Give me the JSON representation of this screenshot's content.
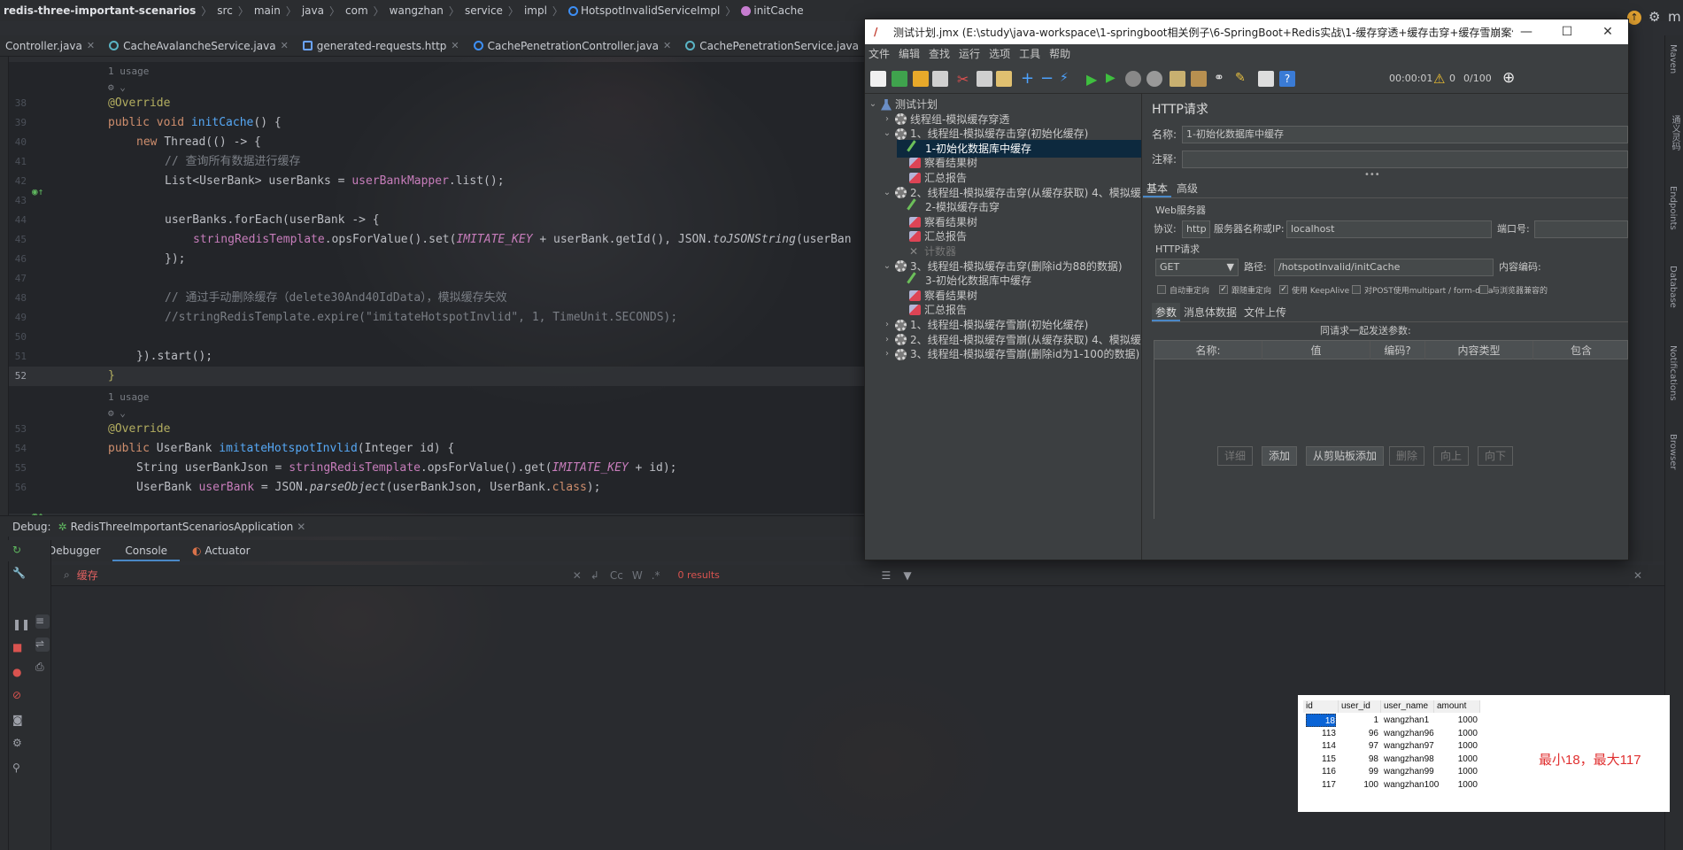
{
  "breadcrumb": [
    "redis-three-important-scenarios",
    "src",
    "main",
    "java",
    "com",
    "wangzhan",
    "service",
    "impl",
    "HotspotInvalidServiceImpl",
    "initCache"
  ],
  "editor_tabs": [
    "Controller.java",
    "CacheAvalancheService.java",
    "generated-requests.http",
    "CachePenetrationController.java",
    "CachePenetrationService.java"
  ],
  "editor": {
    "usage1": "1 usage",
    "usage2": "1 usage",
    "ln": [
      "38",
      "39",
      "40",
      "41",
      "42",
      "43",
      "44",
      "45",
      "46",
      "47",
      "48",
      "49",
      "50",
      "51",
      "52",
      "53",
      "54",
      "55",
      "56"
    ],
    "l38_ann": "@Override",
    "l39_kw": "public void ",
    "l39_fn": "initCache",
    "l39_rest": "() {",
    "l40_kw": "new ",
    "l40_rest": "Thread(() -> {",
    "l41_cmt": "// 查询所有数据进行缓存",
    "l42_a": "List<UserBank> userBanks = ",
    "l42_f": "userBankMapper",
    "l42_b": ".list();",
    "l44_a": "userBanks.forEach(userBank -> {",
    "l45_f": "stringRedisTemplate",
    "l45_a": ".opsForValue().set(",
    "l45_c": "IMITATE_KEY",
    "l45_b": " + userBank.getId(), JSON.",
    "l45_i": "toJSONString",
    "l45_d": "(userBan",
    "l46_a": "});",
    "l48_cmt": "// 通过手动删除缓存（delete30And40IdData），模拟缓存失效",
    "l49_cmt": "//stringRedisTemplate.expire(\"imitateHotspotInvlid\", 1, TimeUnit.SECONDS);",
    "l51_a": "}).start();",
    "l52_a": "}",
    "l53_ann": "@Override",
    "l54_kw": "public ",
    "l54_a": "UserBank ",
    "l54_fn": "imitateHotspotInvlid",
    "l54_b": "(Integer id) {",
    "l55_a": "String userBankJson = ",
    "l55_f": "stringRedisTemplate",
    "l55_b": ".opsForValue().get(",
    "l55_c": "IMITATE_KEY",
    "l55_d": " + id);",
    "l56_a": "UserBank ",
    "l56_f": "userBank",
    "l56_b": " = JSON.",
    "l56_i": "parseObject",
    "l56_c": "(userBankJson, UserBank.",
    "l56_k": "class",
    "l56_d": ");"
  },
  "debug": {
    "label": "Debug:",
    "config": "RedisThreeImportantScenariosApplication",
    "tabs": [
      "Debugger",
      "Console",
      "Actuator"
    ],
    "search_value": "缓存",
    "results": "0 results",
    "opts": [
      "Cc",
      "W"
    ]
  },
  "right_tools": [
    "Maven",
    "通义灵码",
    "Endpoints",
    "Database",
    "Notifications",
    "Browser"
  ],
  "jmeter": {
    "title": "测试计划.jmx (E:\\study\\java-workspace\\1-springboot相关例子\\6-SpringBoot+Redis实战\\1-缓存穿透+缓存击穿+缓存雪崩案例及解...",
    "menu": [
      "文件",
      "编辑",
      "查找",
      "运行",
      "选项",
      "工具",
      "帮助"
    ],
    "timer": "00:00:01",
    "warn_count": "0",
    "threads": "0/100",
    "tree": [
      {
        "label": "测试计划",
        "type": "flask",
        "indent": 0,
        "exp": "v"
      },
      {
        "label": "线程组-模拟缓存穿透",
        "type": "gear",
        "indent": 1,
        "exp": ">"
      },
      {
        "label": "1、线程组-模拟缓存击穿(初始化缓存)",
        "type": "gear",
        "indent": 1,
        "exp": "v"
      },
      {
        "label": "1-初始化数据库中缓存",
        "type": "sampler",
        "indent": 2,
        "exp": "",
        "sel": true
      },
      {
        "label": "察看结果树",
        "type": "listener",
        "indent": 2,
        "exp": ""
      },
      {
        "label": "汇总报告",
        "type": "listener",
        "indent": 2,
        "exp": ""
      },
      {
        "label": "2、线程组-模拟缓存击穿(从缓存获取) 4、模拟缓",
        "type": "gear",
        "indent": 1,
        "exp": "v"
      },
      {
        "label": "2-模拟缓存击穿",
        "type": "sampler",
        "indent": 2,
        "exp": ""
      },
      {
        "label": "察看结果树",
        "type": "listener",
        "indent": 2,
        "exp": ""
      },
      {
        "label": "汇总报告",
        "type": "listener",
        "indent": 2,
        "exp": ""
      },
      {
        "label": "计数器",
        "type": "tool",
        "indent": 2,
        "exp": "",
        "dim": true
      },
      {
        "label": "3、线程组-模拟缓存击穿(删除id为88的数据)",
        "type": "gear",
        "indent": 1,
        "exp": "v"
      },
      {
        "label": "3-初始化数据库中缓存",
        "type": "sampler",
        "indent": 2,
        "exp": ""
      },
      {
        "label": "察看结果树",
        "type": "listener",
        "indent": 2,
        "exp": ""
      },
      {
        "label": "汇总报告",
        "type": "listener",
        "indent": 2,
        "exp": ""
      },
      {
        "label": "1、线程组-模拟缓存雪崩(初始化缓存)",
        "type": "gear",
        "indent": 1,
        "exp": ">"
      },
      {
        "label": "2、线程组-模拟缓存雪崩(从缓存获取) 4、模拟缓",
        "type": "gear",
        "indent": 1,
        "exp": ">"
      },
      {
        "label": "3、线程组-模拟缓存雪崩(删除id为1-100的数据)",
        "type": "gear",
        "indent": 1,
        "exp": ">"
      }
    ],
    "panel": {
      "header": "HTTP请求",
      "name_label": "名称:",
      "name_value": "1-初始化数据库中缓存",
      "comment_label": "注释:",
      "comment_value": "",
      "tabs": [
        "基本",
        "高级"
      ],
      "web_server": "Web服务器",
      "protocol_label": "协议:",
      "protocol_value": "http",
      "server_label": "服务器名称或IP:",
      "server_value": "localhost",
      "port_label": "端口号:",
      "http_section": "HTTP请求",
      "method": "GET",
      "path_label": "路径:",
      "path_value": "/hotspotInvalid/initCache",
      "encoding_label": "内容编码:",
      "checkboxes": [
        {
          "label": "自动重定向",
          "checked": false
        },
        {
          "label": "跟随重定向",
          "checked": true
        },
        {
          "label": "使用 KeepAlive",
          "checked": true
        },
        {
          "label": "对POST使用multipart / form-data",
          "checked": false
        },
        {
          "label": "与浏览器兼容的",
          "checked": false
        }
      ],
      "param_tabs": [
        "参数",
        "消息体数据",
        "文件上传"
      ],
      "params_caption": "同请求一起发送参数:",
      "columns": [
        "名称:",
        "值",
        "编码?",
        "内容类型",
        "包含"
      ],
      "buttons": [
        {
          "label": "详细",
          "enabled": false
        },
        {
          "label": "添加",
          "enabled": true
        },
        {
          "label": "从剪贴板添加",
          "enabled": true
        },
        {
          "label": "删除",
          "enabled": false
        },
        {
          "label": "向上",
          "enabled": false
        },
        {
          "label": "向下",
          "enabled": false
        }
      ]
    }
  },
  "db_table": {
    "columns": [
      "id",
      "user_id",
      "user_name",
      "amount"
    ],
    "rows": [
      [
        "18",
        "1",
        "wangzhan1",
        "1000"
      ],
      [
        "113",
        "96",
        "wangzhan96",
        "1000"
      ],
      [
        "114",
        "97",
        "wangzhan97",
        "1000"
      ],
      [
        "115",
        "98",
        "wangzhan98",
        "1000"
      ],
      [
        "116",
        "99",
        "wangzhan99",
        "1000"
      ],
      [
        "117",
        "100",
        "wangzhan100",
        "1000"
      ]
    ],
    "note": "最小18，最大117"
  },
  "colors": {
    "accent": "#4a88c7",
    "selection": "#0d293e",
    "note": "#e03030"
  }
}
